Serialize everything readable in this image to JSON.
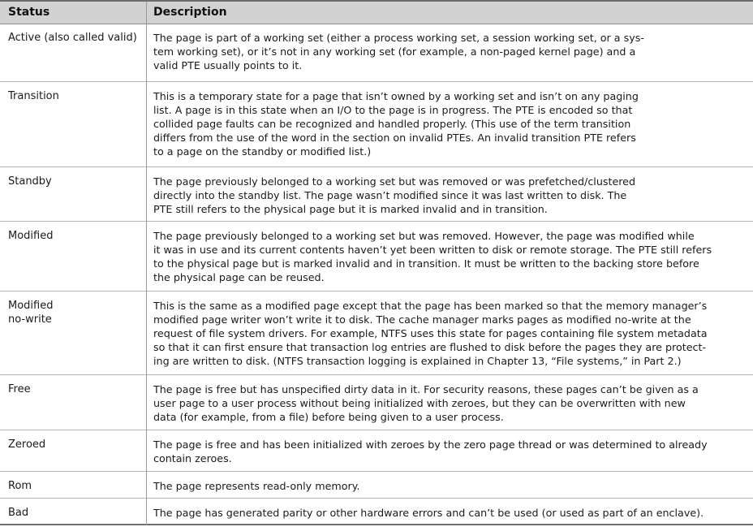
{
  "header": {
    "status": "Status",
    "description": "Description"
  },
  "rows": [
    {
      "status": "Active (also called valid)",
      "lines": [
        "The page is part of a working set (either a process working set, a session working set, or a sys-",
        "tem working set), or it’s not in any working set (for example, a non-paged kernel page) and a",
        "valid PTE usually points to it."
      ]
    },
    {
      "status": "Transition",
      "lines": [
        "This is a temporary state for a page that isn’t owned by a working set and isn’t on any paging",
        "list. A page is in this state when an I/O to the page is in progress. The PTE is encoded so that",
        "collided page faults can be recognized and handled properly. (This use of the term transition",
        "differs from the use of the word in the section on invalid PTEs. An invalid transition PTE refers",
        "to a page on the standby or modified list.)"
      ]
    },
    {
      "status": "Standby",
      "lines": [
        "The page previously belonged to a working set but was removed or was prefetched/clustered",
        "directly into the standby list. The page wasn’t modified since it was last written to disk. The",
        "PTE still refers to the physical page but it is marked invalid and in transition."
      ]
    },
    {
      "status": "Modified",
      "lines": [
        "The page previously belonged to a working set but was removed. However, the page was modified while",
        "it was in use and its current contents haven’t yet been written to disk or remote storage. The PTE still refers",
        "to the physical page but is marked invalid and in transition. It must be written to the backing store before",
        "the physical page can be reused."
      ]
    },
    {
      "status": "Modified\nno-write",
      "lines": [
        "This is the same as a modified page except that the page has been marked so that the memory manager’s",
        "modified page writer won’t write it to disk. The cache manager marks pages as modified no-write at the",
        "request of file system drivers. For example, NTFS uses this state for pages containing file system metadata",
        "so that it can first ensure that transaction log entries are flushed to disk before the pages they are protect-",
        "ing are written to disk. (NTFS transaction logging is explained in Chapter 13, “File systems,” in Part 2.)"
      ]
    },
    {
      "status": "Free",
      "lines": [
        "The page is free but has unspecified dirty data in it. For security reasons, these pages can’t be given as a",
        "user page to a user process without being initialized with zeroes, but they can be overwritten with new",
        "data (for example, from a file) before being given to a user process."
      ]
    },
    {
      "status": "Zeroed",
      "lines": [
        "The page is free and has been initialized with zeroes by the zero page thread or was determined to already",
        "contain zeroes."
      ]
    },
    {
      "status": "Rom",
      "lines": [
        "The page represents read-only memory."
      ]
    },
    {
      "status": "Bad",
      "lines": [
        "The page has generated parity or other hardware errors and can’t be used (or used as part of an enclave)."
      ]
    }
  ]
}
